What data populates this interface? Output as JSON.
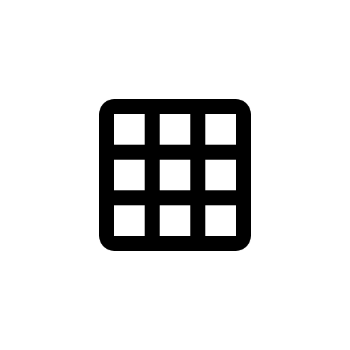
{
  "icon": {
    "name": "grid-icon",
    "color": "#000000",
    "background": "#ffffff",
    "rows": 3,
    "columns": 3
  }
}
